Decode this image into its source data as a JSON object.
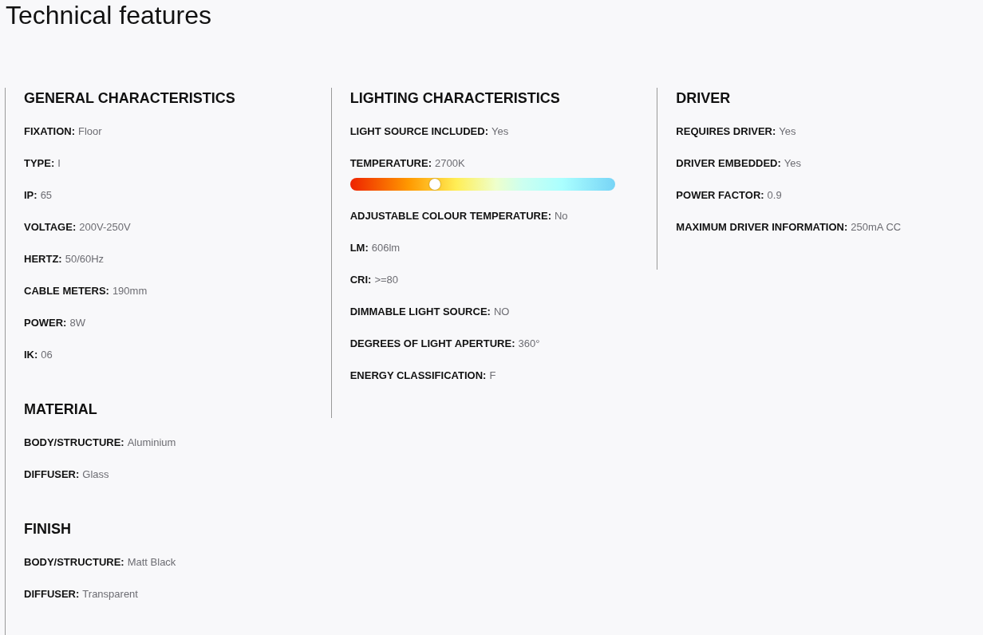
{
  "title": "Technical features",
  "columns": [
    {
      "sections": [
        {
          "heading": "GENERAL CHARACTERISTICS",
          "rows": [
            {
              "label": "FIXATION:",
              "value": "Floor"
            },
            {
              "label": "TYPE:",
              "value": "I"
            },
            {
              "label": "IP:",
              "value": "65"
            },
            {
              "label": "VOLTAGE:",
              "value": "200V-250V"
            },
            {
              "label": "HERTZ:",
              "value": "50/60Hz"
            },
            {
              "label": "CABLE METERS:",
              "value": "190mm"
            },
            {
              "label": "POWER:",
              "value": "8W"
            },
            {
              "label": "IK:",
              "value": "06"
            }
          ]
        },
        {
          "heading": "MATERIAL",
          "rows": [
            {
              "label": "BODY/STRUCTURE:",
              "value": "Aluminium"
            },
            {
              "label": "DIFFUSER:",
              "value": "Glass"
            }
          ]
        },
        {
          "heading": "FINISH",
          "rows": [
            {
              "label": "BODY/STRUCTURE:",
              "value": "Matt Black"
            },
            {
              "label": "DIFFUSER:",
              "value": "Transparent"
            }
          ]
        }
      ]
    },
    {
      "sections": [
        {
          "heading": "LIGHTING CHARACTERISTICS",
          "rows": [
            {
              "label": "LIGHT SOURCE INCLUDED:",
              "value": "Yes"
            },
            {
              "kind": "scale",
              "label": "TEMPERATURE:",
              "value": "2700K",
              "level": 0.32
            },
            {
              "label": "ADJUSTABLE COLOUR TEMPERATURE:",
              "value": "No"
            },
            {
              "label": "LM:",
              "value": "606lm"
            },
            {
              "label": "CRI:",
              "value": ">=80"
            },
            {
              "label": "DIMMABLE LIGHT SOURCE:",
              "value": "NO"
            },
            {
              "label": "DEGREES OF LIGHT APERTURE:",
              "value": "360°"
            },
            {
              "label": "ENERGY CLASSIFICATION:",
              "value": "F"
            }
          ]
        }
      ]
    },
    {
      "sections": [
        {
          "heading": "DRIVER",
          "rows": [
            {
              "label": "REQUIRES DRIVER:",
              "value": "Yes"
            },
            {
              "label": "DRIVER EMBEDDED:",
              "value": "Yes"
            },
            {
              "label": "POWER FACTOR:",
              "value": "0.9"
            },
            {
              "label": "MAXIMUM DRIVER INFORMATION:",
              "value": "250mA CC"
            }
          ]
        }
      ]
    }
  ]
}
